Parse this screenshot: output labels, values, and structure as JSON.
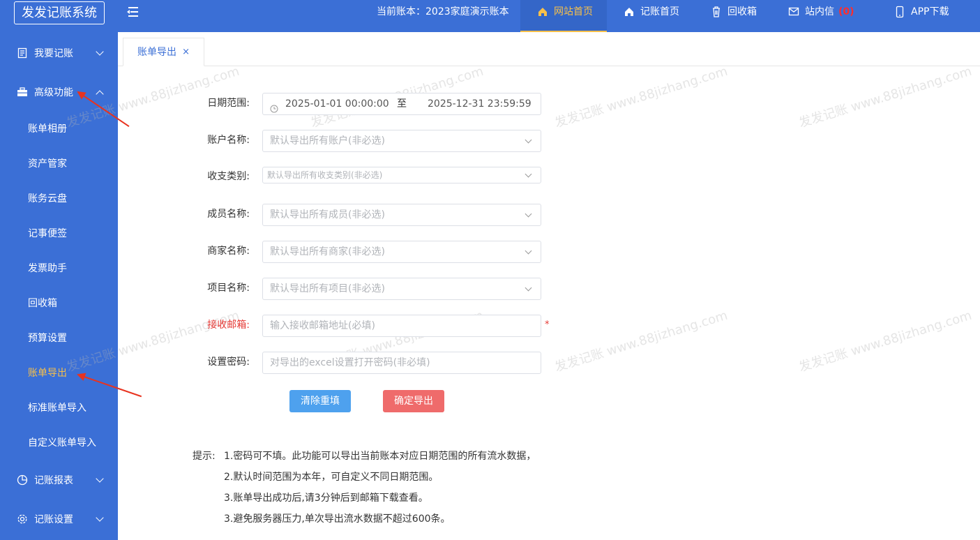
{
  "header": {
    "logo": "发发记账系统",
    "account": "当前账本：2023家庭演示账本",
    "nav": [
      {
        "label": "网站首页",
        "icon": "home-icon"
      },
      {
        "label": "记账首页",
        "icon": "home-icon"
      },
      {
        "label": "回收箱",
        "icon": "trash-icon"
      },
      {
        "label": "站内信",
        "icon": "mail-icon",
        "badge": "(0)"
      },
      {
        "label": "APP下载",
        "icon": "phone-icon"
      }
    ]
  },
  "sidebar": {
    "groups": [
      {
        "label": "我要记账",
        "icon": "document-icon"
      },
      {
        "label": "高级功能",
        "icon": "toolbox-icon"
      },
      {
        "label": "记账报表",
        "icon": "pie-chart-icon"
      },
      {
        "label": "记账设置",
        "icon": "gear-icon"
      }
    ],
    "sub_items": [
      "账单相册",
      "资产管家",
      "账务云盘",
      "记事便签",
      "发票助手",
      "回收箱",
      "预算设置",
      "账单导出",
      "标准账单导入",
      "自定义账单导入"
    ]
  },
  "tab": {
    "label": "账单导出",
    "close": "×"
  },
  "watermark": "发发记账 www.88jizhang.com",
  "form": {
    "date_label": "日期范围:",
    "date_start": "2025-01-01 00:00:00",
    "date_sep": "至",
    "date_end": "2025-12-31 23:59:59",
    "account_label": "账户名称:",
    "account_placeholder": "默认导出所有账户(非必选)",
    "category_label": "收支类别:",
    "category_placeholder": "默认导出所有收支类别(非必选)",
    "member_label": "成员名称:",
    "member_placeholder": "默认导出所有成员(非必选)",
    "merchant_label": "商家名称:",
    "merchant_placeholder": "默认导出所有商家(非必选)",
    "project_label": "项目名称:",
    "project_placeholder": "默认导出所有项目(非必选)",
    "email_label": "接收邮箱:",
    "email_placeholder": "输入接收邮箱地址(必填)",
    "required_mark": "*",
    "password_label": "设置密码:",
    "password_placeholder": "对导出的excel设置打开密码(非必填)",
    "reset_button": "清除重填",
    "export_button": "确定导出"
  },
  "tips": {
    "label": "提示:",
    "lines": [
      "1.密码可不填。此功能可以导出当前账本对应日期范围的所有流水数据，",
      "2.默认时间范围为本年，可自定义不同日期范围。",
      "3.账单导出成功后,请3分钟后到邮箱下载查看。",
      "3.避免服务器压力,单次导出流水数据不超过600条。"
    ]
  },
  "colors": {
    "primary": "#3b6fd6",
    "active": "#f7c04a",
    "danger": "#ef6b6b",
    "info": "#4ea1ee"
  }
}
